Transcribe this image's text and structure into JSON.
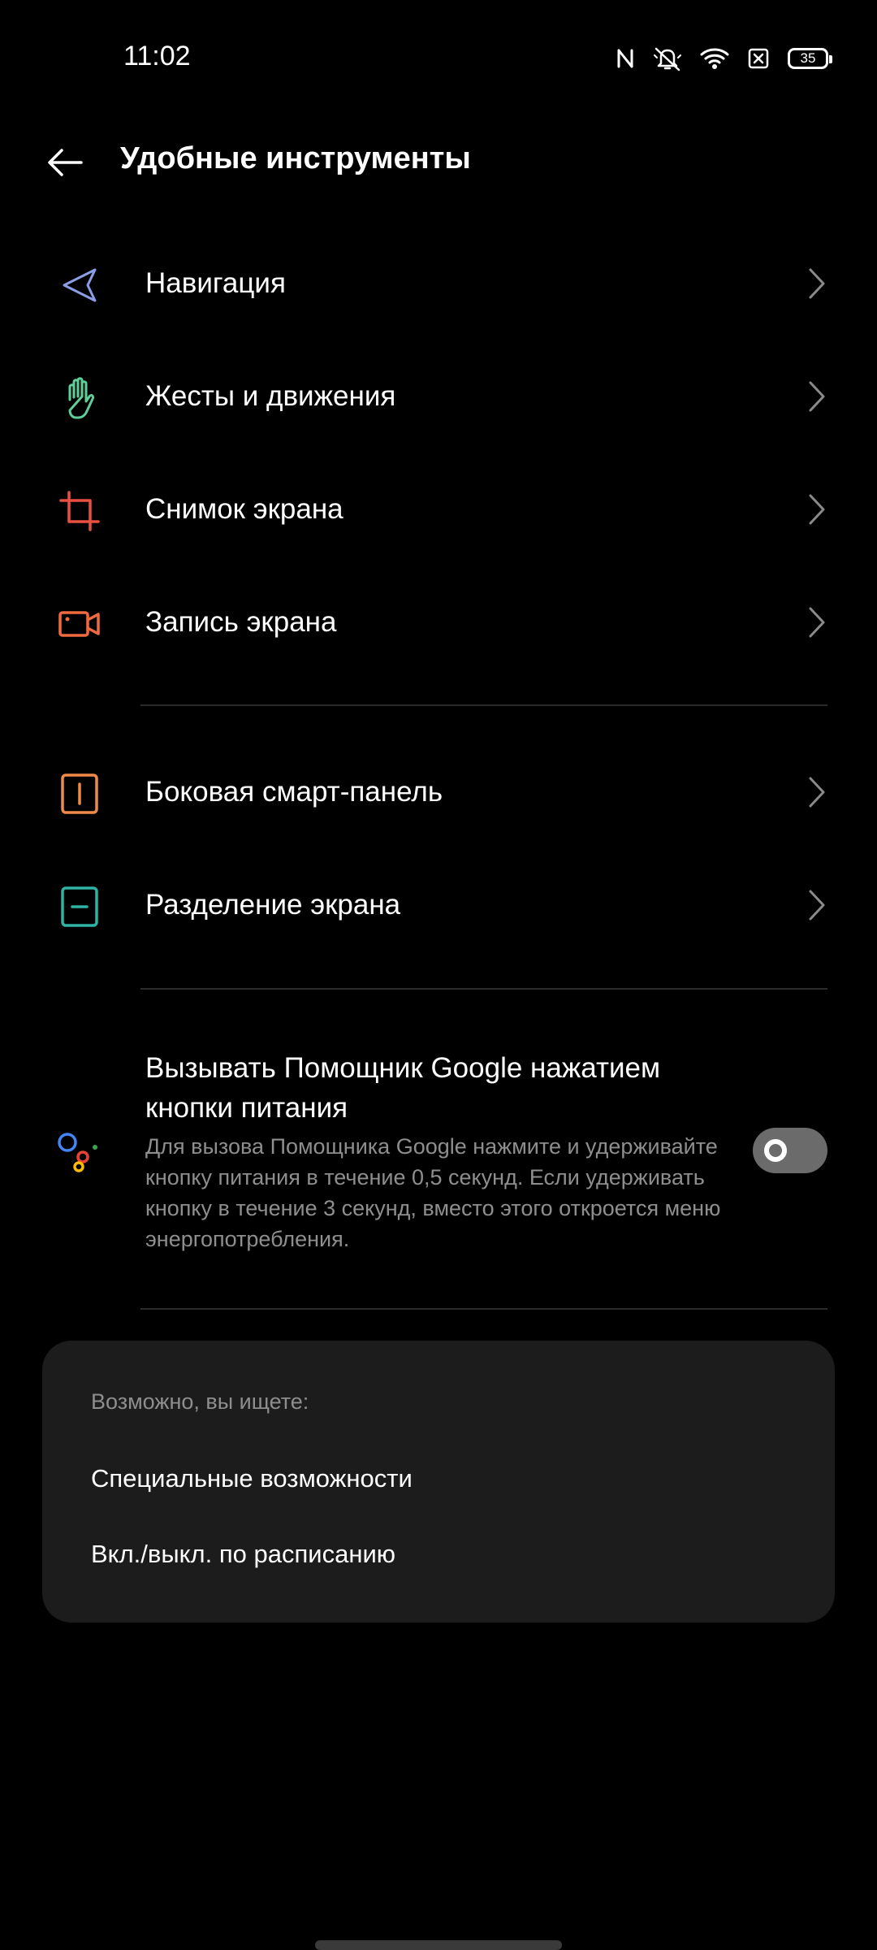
{
  "status_bar": {
    "time": "11:02",
    "battery_level": "35"
  },
  "header": {
    "title": "Удобные инструменты"
  },
  "menu": {
    "items": [
      {
        "label": "Навигация",
        "icon": "navigation-arrow-icon"
      },
      {
        "label": "Жесты и движения",
        "icon": "hand-icon"
      },
      {
        "label": "Снимок экрана",
        "icon": "crop-icon"
      },
      {
        "label": "Запись экрана",
        "icon": "video-camera-icon"
      },
      {
        "label": "Боковая смарт-панель",
        "icon": "side-panel-icon"
      },
      {
        "label": "Разделение экрана",
        "icon": "split-screen-icon"
      }
    ]
  },
  "assistant": {
    "title": "Вызывать Помощник Google нажатием кнопки питания",
    "description": "Для вызова Помощника Google нажмите и удерживайте кнопку питания в течение 0,5 секунд. Если удерживать кнопку в течение 3 секунд, вместо этого откроется меню энергопотребления.",
    "enabled": false
  },
  "suggestions": {
    "heading": "Возможно, вы ищете:",
    "items": [
      "Специальные возможности",
      "Вкл./выкл. по расписанию"
    ]
  },
  "colors": {
    "background": "#000000",
    "card": "#1c1c1c",
    "secondary_text": "#8e8e8e",
    "navigation_icon": "#8a9ee6",
    "gestures_icon": "#5fcf9a",
    "screenshot_icon": "#e9503f",
    "record_icon": "#ef6a3f",
    "side_panel_icon": "#f08a4b",
    "split_screen_icon": "#2eb3a5",
    "google_blue": "#4285f4",
    "google_red": "#ea4335",
    "google_yellow": "#fbbc05",
    "google_green": "#34a853"
  }
}
